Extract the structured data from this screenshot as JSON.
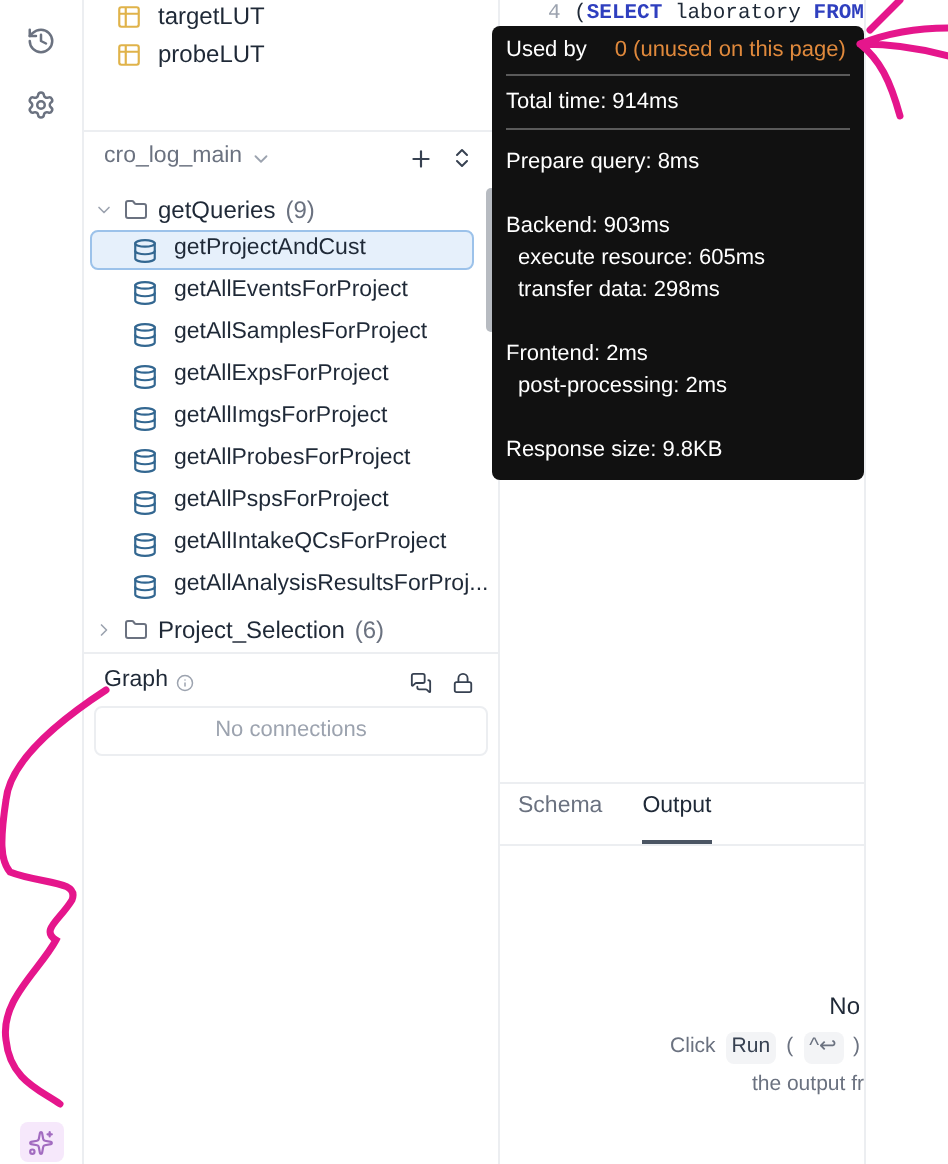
{
  "tables": [
    {
      "name": "targetLUT"
    },
    {
      "name": "probeLUT"
    }
  ],
  "workspace": {
    "name": "cro_log_main"
  },
  "tree": [
    {
      "label": "getQueries",
      "count": "(9)",
      "expanded": true,
      "children": [
        {
          "label": "getProjectAndCust",
          "selected": true
        },
        {
          "label": "getAllEventsForProject",
          "selected": false
        },
        {
          "label": "getAllSamplesForProject",
          "selected": false
        },
        {
          "label": "getAllExpsForProject",
          "selected": false
        },
        {
          "label": "getAllImgsForProject",
          "selected": false
        },
        {
          "label": "getAllProbesForProject",
          "selected": false
        },
        {
          "label": "getAllPspsForProject",
          "selected": false
        },
        {
          "label": "getAllIntakeQCsForProject",
          "selected": false
        },
        {
          "label": "getAllAnalysisResultsForProj...",
          "selected": false
        }
      ]
    },
    {
      "label": "Project_Selection",
      "count": "(6)",
      "expanded": false
    }
  ],
  "graph": {
    "title": "Graph",
    "empty": "No connections"
  },
  "editor": {
    "line_number": "4",
    "code": [
      {
        "kind": "plain",
        "text": "("
      },
      {
        "kind": "keyword",
        "text": "SELECT"
      },
      {
        "kind": "plain",
        "text": " laboratory "
      },
      {
        "kind": "keyword",
        "text": "FROM"
      }
    ]
  },
  "tooltip": {
    "used_by_label": "Used by",
    "used_by_value": "0 (unused on this page)",
    "total": "Total time: 914ms",
    "groups": [
      {
        "lines": [
          {
            "text": "Prepare query: 8ms",
            "indent": false
          }
        ]
      },
      {
        "lines": [
          {
            "text": "Backend: 903ms",
            "indent": false
          },
          {
            "text": "execute resource: 605ms",
            "indent": true
          },
          {
            "text": "transfer data: 298ms",
            "indent": true
          }
        ]
      },
      {
        "lines": [
          {
            "text": "Frontend: 2ms",
            "indent": false
          },
          {
            "text": "post-processing: 2ms",
            "indent": true
          }
        ]
      },
      {
        "lines": [
          {
            "text": "Response size: 9.8KB",
            "indent": false
          }
        ]
      }
    ]
  },
  "tabs": [
    {
      "label": "Schema",
      "selected": false
    },
    {
      "label": "Output",
      "selected": true
    }
  ],
  "output": {
    "title": "No",
    "click": "Click",
    "run_key": "Run",
    "open_paren": "(",
    "shortcut": "^↩",
    "close_paren": ")",
    "second_line": "the output fr"
  }
}
